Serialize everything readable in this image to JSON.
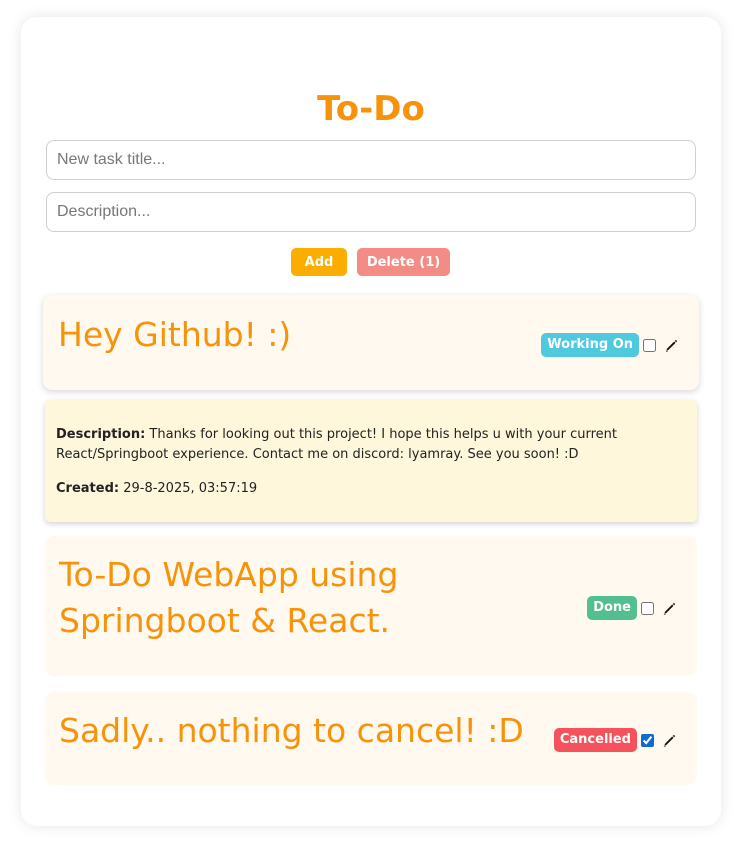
{
  "app": {
    "title": "To-Do"
  },
  "form": {
    "title_placeholder": "New task title...",
    "description_placeholder": "Description...",
    "add_label": "Add",
    "delete_label": "Delete (1)"
  },
  "tasks": [
    {
      "title": "Hey Github! :)",
      "status": "Working On",
      "status_color": "#4fc9de",
      "checked": false,
      "expanded": true
    },
    {
      "title": "To-Do WebApp using Springboot & React.",
      "status": "Done",
      "status_color": "#52c08e",
      "checked": false,
      "expanded": false
    },
    {
      "title": "Sadly.. nothing to cancel! :D",
      "status": "Cancelled",
      "status_color": "#f4525c",
      "checked": true,
      "expanded": false
    }
  ],
  "details": {
    "description_label": "Description:",
    "description_text": "Thanks for looking out this project! I hope this helps u with your current React/Springboot experience. Contact me on discord: lyamray. See you soon! :D",
    "created_label": "Created:",
    "created_value": "29-8-2025, 03:57:19"
  },
  "colors": {
    "accent": "#f7930a",
    "add_button": "#fbae00",
    "delete_button": "#f28c84",
    "card_background": "#fff9f0",
    "details_background": "#fff7dc"
  },
  "icons": {
    "edit": "pencil-icon"
  }
}
